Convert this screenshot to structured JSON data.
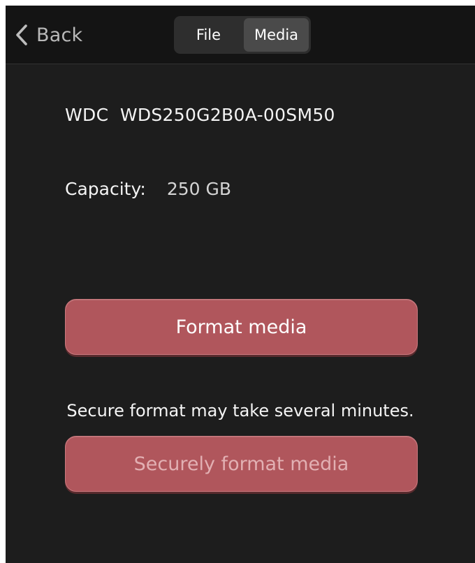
{
  "nav": {
    "back_label": "Back",
    "back_icon": "chevron-left-icon"
  },
  "tabs": [
    {
      "label": "File",
      "active": false
    },
    {
      "label": "Media",
      "active": true
    }
  ],
  "media": {
    "device_name": "WDC  WDS250G2B0A-00SM50",
    "capacity_label": "Capacity:",
    "capacity_value": "250 GB"
  },
  "actions": {
    "format_label": "Format media",
    "secure_note": "Secure format may take several minutes.",
    "secure_format_label": "Securely format media"
  },
  "colors": {
    "background": "#1d1d1d",
    "topbar": "#141414",
    "button": "#b0565c"
  }
}
